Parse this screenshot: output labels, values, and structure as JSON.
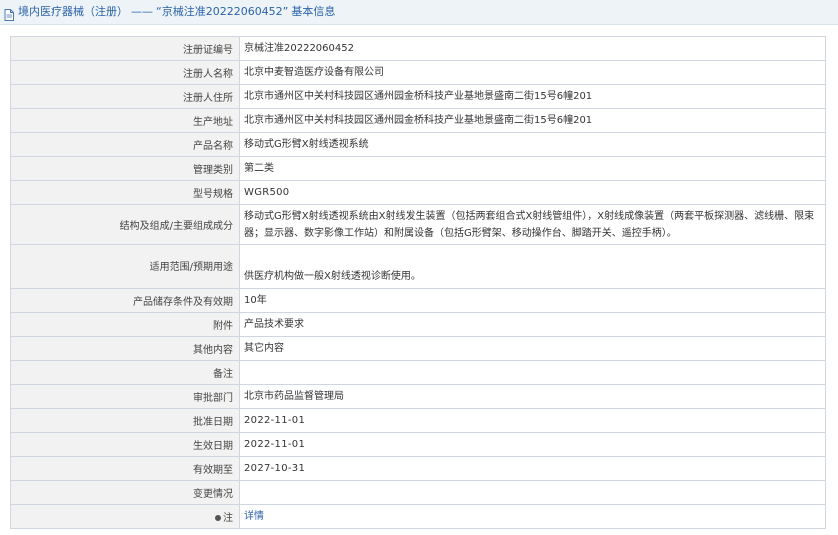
{
  "breadcrumb": {
    "category": "境内医疗器械（注册）",
    "separator": "——",
    "record": "“京械注准20222060452”",
    "section": "基本信息"
  },
  "rows": [
    {
      "label": "注册证编号",
      "value": "京械注准20222060452"
    },
    {
      "label": "注册人名称",
      "value": "北京中麦智造医疗设备有限公司"
    },
    {
      "label": "注册人住所",
      "value": "北京市通州区中关村科技园区通州园金桥科技产业基地景盛南二街15号6幢201"
    },
    {
      "label": "生产地址",
      "value": "北京市通州区中关村科技园区通州园金桥科技产业基地景盛南二街15号6幢201"
    },
    {
      "label": "产品名称",
      "value": "移动式G形臂X射线透视系统"
    },
    {
      "label": "管理类别",
      "value": "第二类"
    },
    {
      "label": "型号规格",
      "value": "WGR500"
    },
    {
      "label": "结构及组成/主要组成成分",
      "value": "移动式G形臂X射线透视系统由X射线发生装置（包括两套组合式X射线管组件），X射线成像装置（两套平板探测器、滤线栅、限束器；显示器、数字影像工作站）和附属设备（包括G形臂架、移动操作台、脚踏开关、遥控手柄）。"
    },
    {
      "label": "适用范围/预期用途",
      "value": "供医疗机构做一般X射线透视诊断使用。"
    },
    {
      "label": "产品储存条件及有效期",
      "value": "10年"
    },
    {
      "label": "附件",
      "value": "产品技术要求"
    },
    {
      "label": "其他内容",
      "value": "其它内容"
    },
    {
      "label": "备注",
      "value": ""
    },
    {
      "label": "审批部门",
      "value": "北京市药品监督管理局"
    },
    {
      "label": "批准日期",
      "value": "2022-11-01"
    },
    {
      "label": "生效日期",
      "value": "2022-11-01"
    },
    {
      "label": "有效期至",
      "value": "2027-10-31"
    },
    {
      "label": "变更情况",
      "value": ""
    },
    {
      "label": "注",
      "value": "详情"
    }
  ],
  "colors": {
    "link": "#2a63a8",
    "label_bg": "#f2f2f2",
    "header_bg": "#eef3f8",
    "border": "#cfd6de"
  },
  "icons": {
    "header": "document-icon",
    "note": "bullet-icon"
  }
}
